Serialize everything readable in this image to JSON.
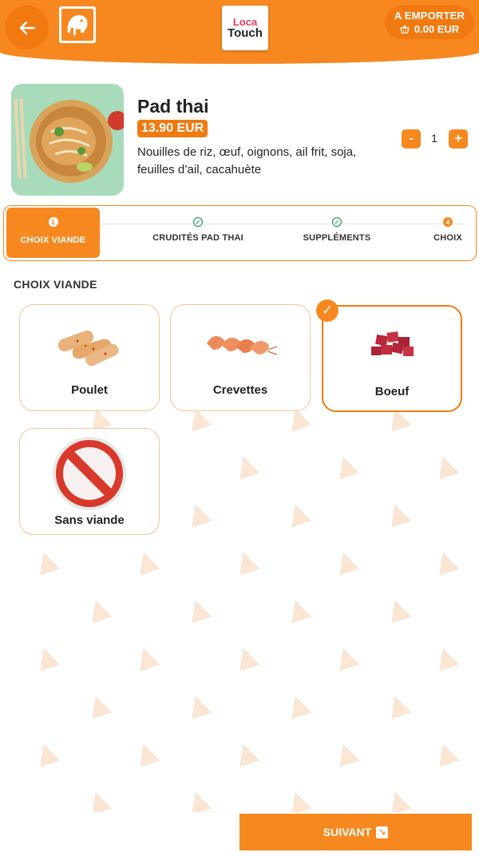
{
  "header": {
    "mode": "A EMPORTER",
    "total": "0.00 EUR",
    "brand_line1": "Loca",
    "brand_line2": "Touch",
    "back_icon": "arrow-left-icon",
    "cart_icon": "basket-icon"
  },
  "product": {
    "title": "Pad thai",
    "price": "13.90 EUR",
    "description": "Nouilles de riz, œuf, oignons, ail frit, soja, feuilles d’ail, cacahuète",
    "quantity": "1",
    "minus_label": "-",
    "plus_label": "+"
  },
  "steps": [
    {
      "number": "1",
      "label": "CHOIX VIANDE",
      "state": "active"
    },
    {
      "number": "",
      "label": "CRUDITÉS PAD THAI",
      "state": "done"
    },
    {
      "number": "",
      "label": "SUPPLÉMENTS",
      "state": "done"
    },
    {
      "number": "4",
      "label": "CHOIX",
      "state": "pending"
    }
  ],
  "section": {
    "title": "CHOIX VIANDE",
    "options": [
      {
        "name": "Poulet",
        "selected": false
      },
      {
        "name": "Crevettes",
        "selected": false
      },
      {
        "name": "Boeuf",
        "selected": true
      },
      {
        "name": "Sans viande",
        "selected": false
      }
    ],
    "selected_mark": "✓"
  },
  "footer": {
    "next_label": "SUIVANT",
    "next_icon": "arrow-down-right-icon"
  },
  "colors": {
    "accent": "#f7881f",
    "accent_dark": "#f07a10",
    "done_green": "#2d8a5a"
  }
}
